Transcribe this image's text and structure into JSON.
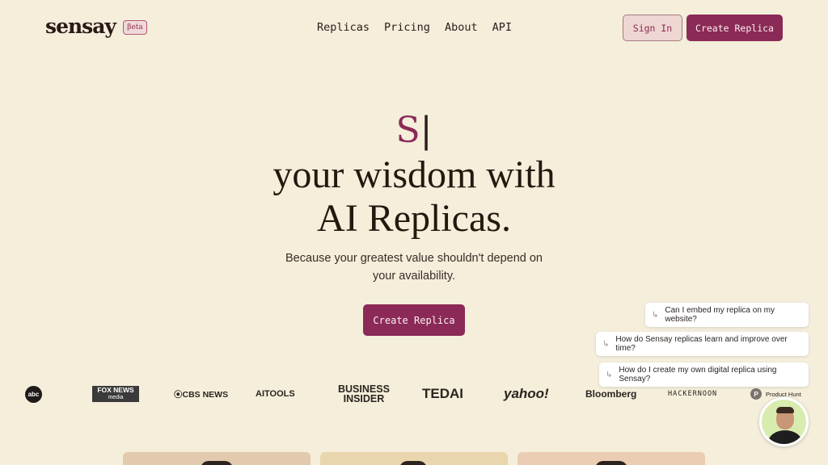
{
  "header": {
    "logo": "sensay",
    "badge": "βeta",
    "nav": [
      "Replicas",
      "Pricing",
      "About",
      "API"
    ],
    "sign_in": "Sign In",
    "create_replica": "Create Replica"
  },
  "hero": {
    "typed_word": "S",
    "caret": "|",
    "line1": "your wisdom with",
    "line2": "AI Replicas.",
    "subtitle": "Because your greatest value shouldn't depend on your availability.",
    "cta": "Create Replica"
  },
  "press_logos": {
    "abc": "abc",
    "fox_top": "FOX NEWS",
    "fox_bottom": "media",
    "cbs": "⦿CBS NEWS",
    "aitools": "AITOOLS",
    "bi_top": "BUSINESS",
    "bi_bottom": "INSIDER",
    "tedai": "TEDAI",
    "yahoo": "yahoo!",
    "bloomberg": "Bloomberg",
    "hackernoon": "HACKERNOON",
    "producthunt": "Product Hunt",
    "producthunt_letter": "P"
  },
  "chat": {
    "arrow": "↳",
    "suggestions": [
      "Can I embed my replica on my website?",
      "How do Sensay replicas learn and improve over time?",
      "How do I create my own digital replica using Sensay?"
    ]
  },
  "colors": {
    "background": "#f4eedb",
    "accent": "#8b2a56"
  }
}
